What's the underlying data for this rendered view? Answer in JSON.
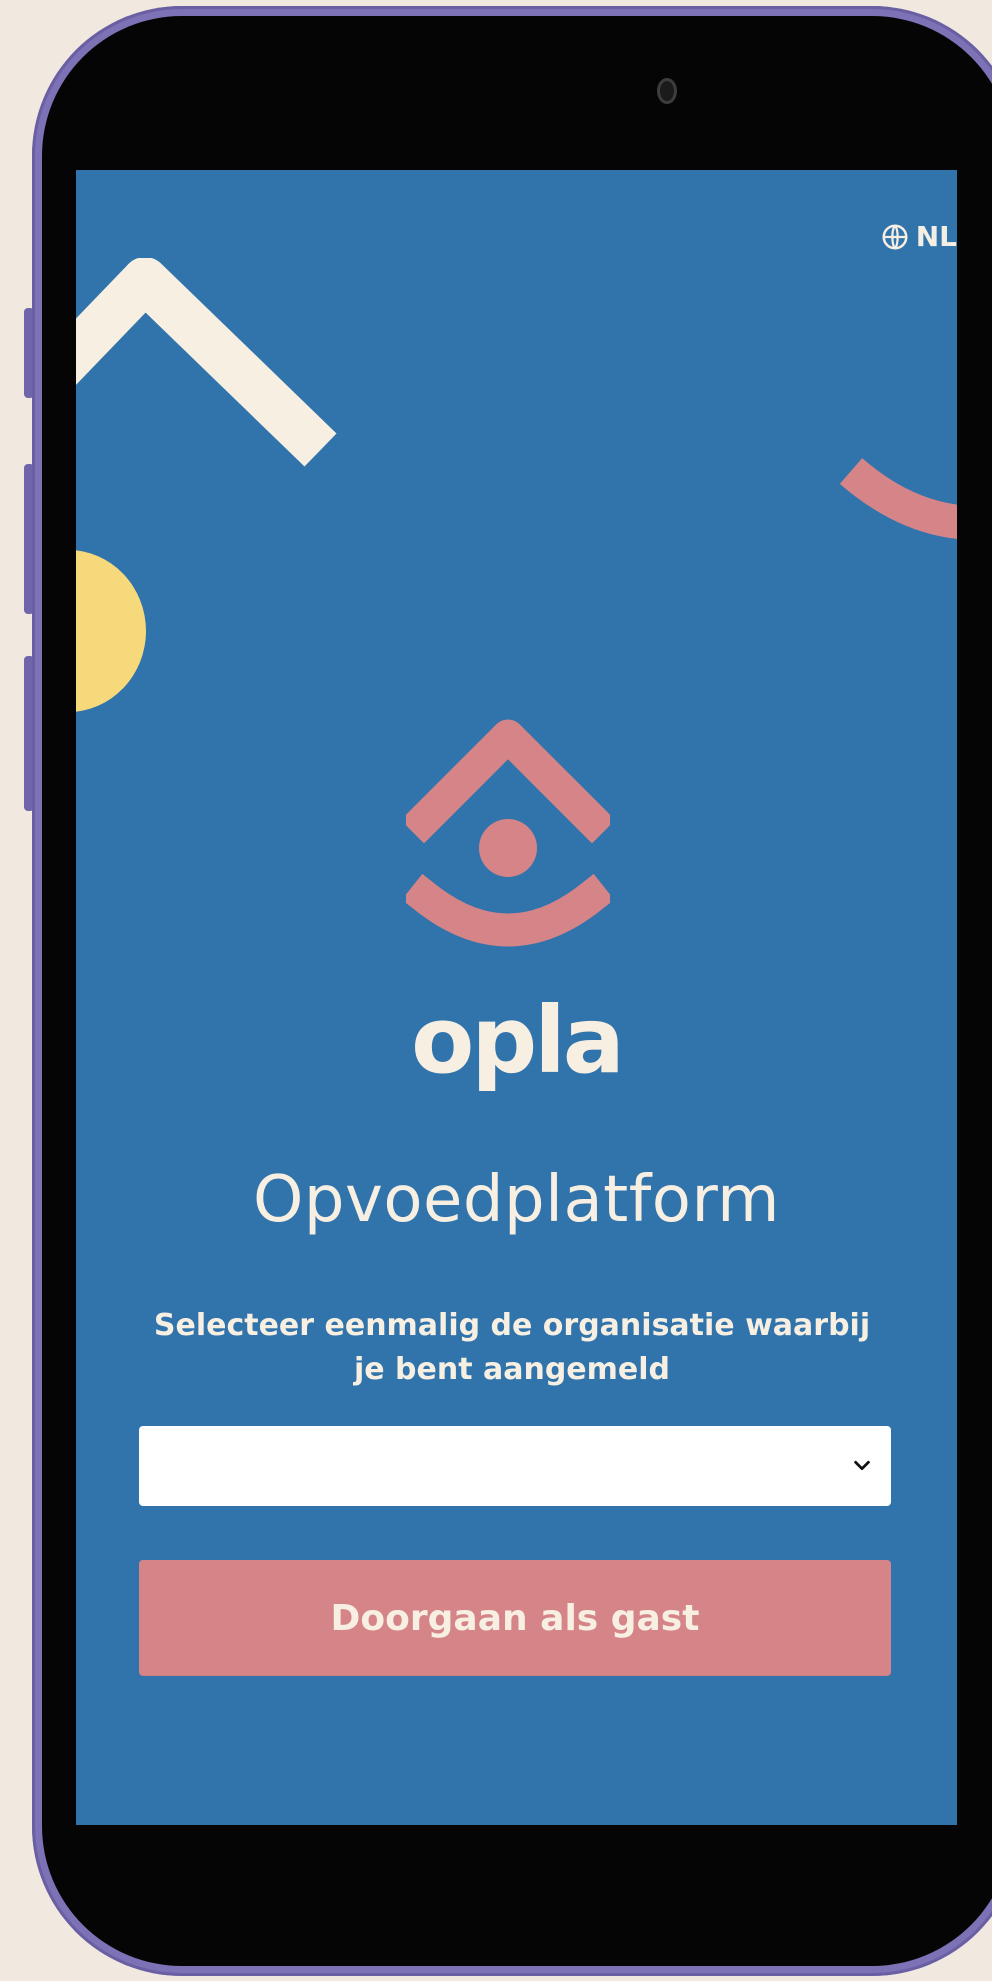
{
  "app": {
    "language_code": "NL",
    "logo_word": "opla",
    "title": "Opvoedplatform",
    "instructions_line_1": "Selecteer eenmalig de organisatie waarbij",
    "instructions_line_2": "je bent aangemeld",
    "organization_selected": "",
    "guest_button_label": "Doorgaan als gast"
  },
  "icons": {
    "language": "globe-icon",
    "select": "chevron-down-icon",
    "logo": "opla-house-icon"
  },
  "colors": {
    "screen_background": "#3173ab",
    "brand_pink": "#d58488",
    "cream": "#f7efe2",
    "accent_yellow": "#f6d97b",
    "phone_frame": "#7d72b6",
    "page_background": "#f1e9df"
  }
}
